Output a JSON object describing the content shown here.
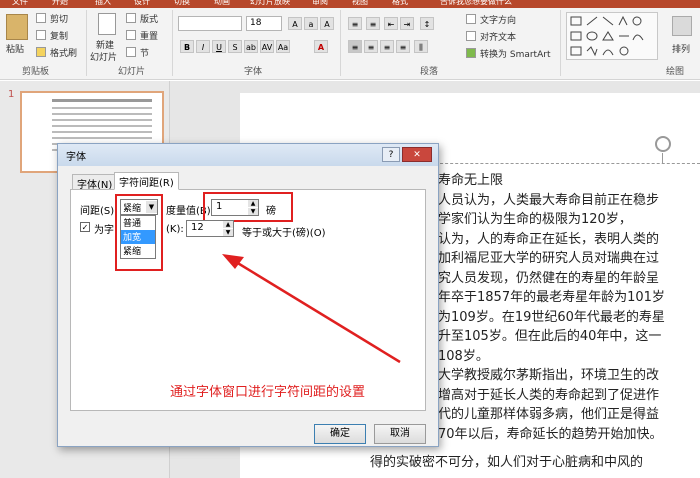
{
  "ribbon": {
    "tabs": [
      "文件",
      "开始",
      "插入",
      "设计",
      "切换",
      "动画",
      "幻灯片放映",
      "审阅",
      "视图",
      "格式"
    ],
    "tell_me": "告诉我您想要做什么",
    "clipboard": {
      "paste": "粘贴",
      "cut": "剪切",
      "copy": "复制",
      "format_painter": "格式刷",
      "group": "剪贴板"
    },
    "slides": {
      "new_slide_l1": "新建",
      "new_slide_l2": "幻灯片",
      "layout": "版式",
      "reset": "重置",
      "section": "节",
      "group": "幻灯片"
    },
    "font": {
      "size": "18",
      "group": "字体"
    },
    "paragraph": {
      "text_direction": "文字方向",
      "align_text": "对齐文本",
      "smartart": "转换为 SmartArt",
      "group": "段落"
    },
    "drawing": {
      "arrange": "排列",
      "group": "绘图"
    }
  },
  "thumbnails": {
    "slide_number": "1"
  },
  "slide_text": [
    "寿命无上限",
    "人员认为，人类最大寿命目前正在稳步",
    "学家们认为生命的极限为120岁，",
    "认为，人的寿命正在延长，表明人类的",
    "加利福尼亚大学的研究人员对瑞典在过",
    "究人员发现，仍然健在的寿星的年龄呈",
    "年卒于1857年的最老寿星年龄为101岁",
    "为109岁。在19世纪60年代最老的寿星",
    "升至105岁。但在此后的40年中，这一",
    "108岁。",
    "大学教授威尔茅斯指出，环境卫生的改",
    "增高对于延长人类的寿命起到了促进作",
    "代的儿童那样体弱多病，他们正是得益",
    "70年以后，寿命延长的趋势开始加快。",
    "得的实破密不可分，如人们对于心脏病和中风的"
  ],
  "dialog": {
    "title": "字体",
    "help": "?",
    "close": "✕",
    "tabs": [
      "字体(N)",
      "字符间距(R)"
    ],
    "spacing_label": "间距(S):",
    "spacing_value": "紧缩",
    "spacing_options": [
      "普通",
      "加宽",
      "紧缩"
    ],
    "measure_label": "度量值(B)",
    "measure_value": "1",
    "measure_unit": "磅",
    "kerning_label_prefix": "为字",
    "kerning_label_suffix": "(K):",
    "kerning_value": "12",
    "kerning_unit": "等于或大于(磅)(O)",
    "ok": "确定",
    "cancel": "取消"
  },
  "annotation": {
    "text": "通过字体窗口进行字符间距的设置",
    "color": "#e02020"
  },
  "colors": {
    "accent": "#b7472a",
    "highlight": "#3399ff"
  }
}
